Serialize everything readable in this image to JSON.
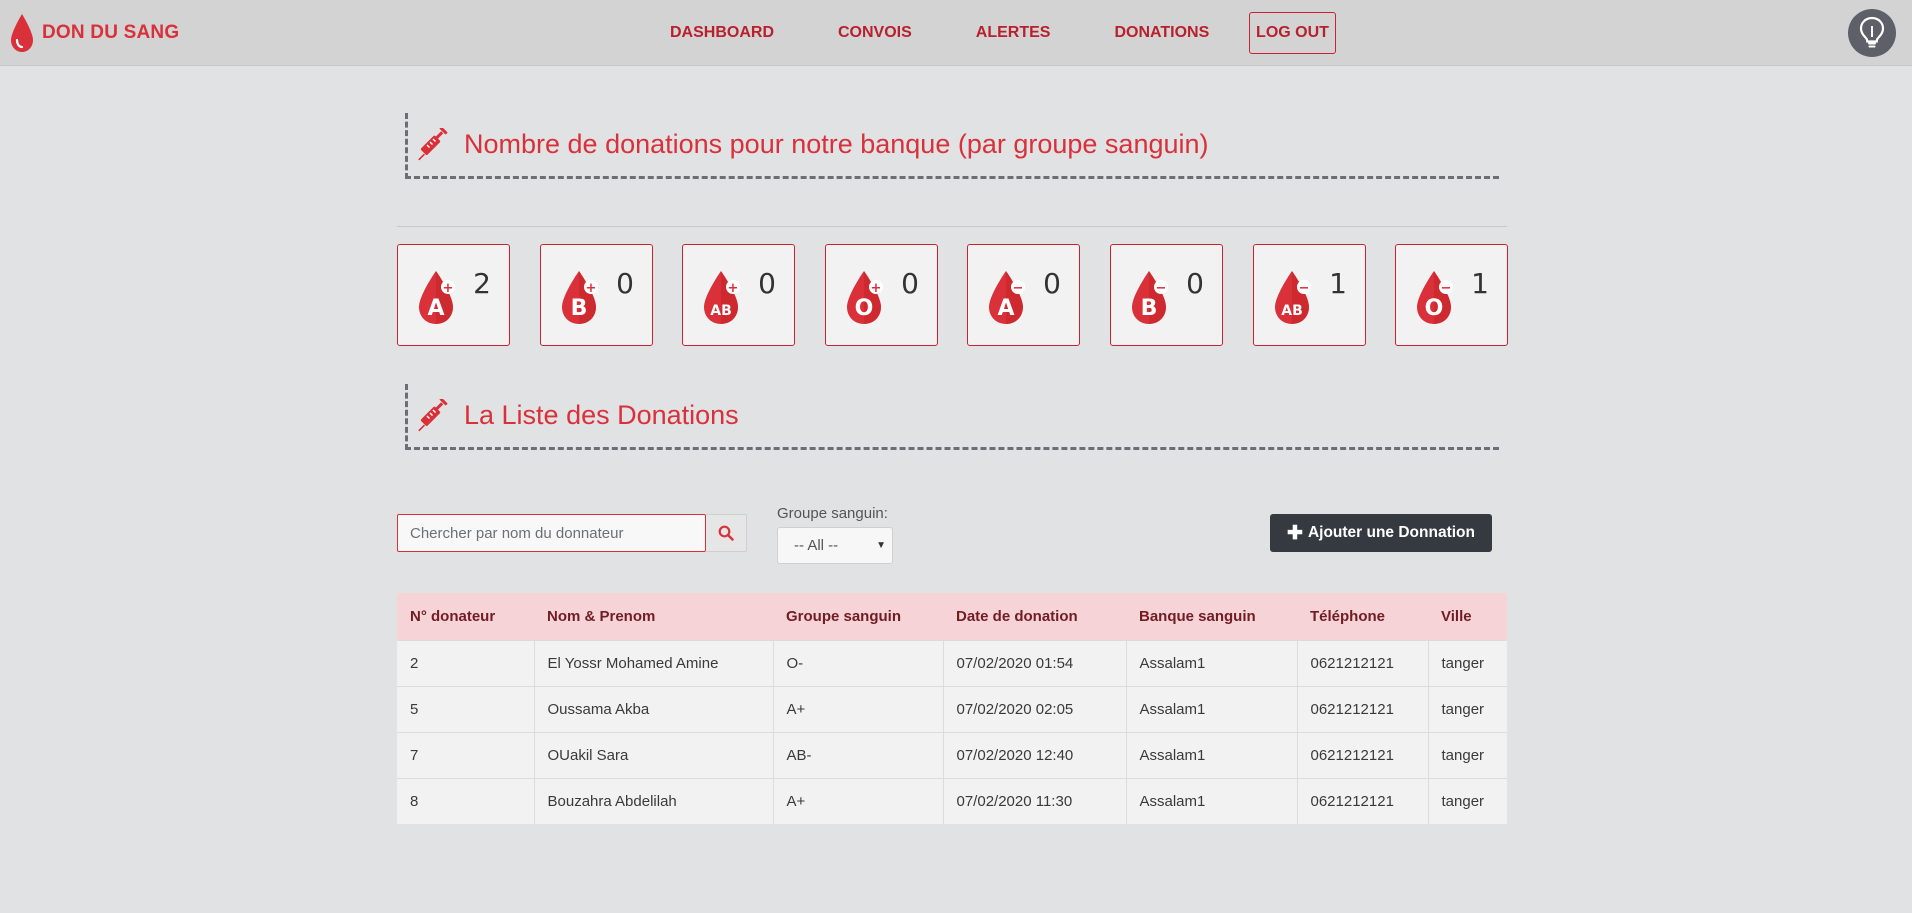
{
  "brand": {
    "name": "DON DU SANG",
    "color": "#d9303a",
    "icon": "blood-drop-icon"
  },
  "nav": {
    "items": [
      "DASHBOARD",
      "CONVOIS",
      "ALERTES",
      "DONATIONS"
    ],
    "logout": "LOG OUT",
    "help_icon": "lightbulb-icon"
  },
  "summary": {
    "title": "Nombre de donations pour notre banque (par groupe sanguin)",
    "icon": "syringe-icon",
    "groups": [
      {
        "type": "A",
        "sign": "+",
        "count": "2"
      },
      {
        "type": "B",
        "sign": "+",
        "count": "0"
      },
      {
        "type": "AB",
        "sign": "+",
        "count": "0"
      },
      {
        "type": "O",
        "sign": "+",
        "count": "0"
      },
      {
        "type": "A",
        "sign": "-",
        "count": "0"
      },
      {
        "type": "B",
        "sign": "-",
        "count": "0"
      },
      {
        "type": "AB",
        "sign": "-",
        "count": "1"
      },
      {
        "type": "O",
        "sign": "-",
        "count": "1"
      }
    ]
  },
  "list": {
    "title": "La Liste des Donations",
    "icon": "syringe-icon",
    "search": {
      "placeholder": "Chercher par nom du donnateur",
      "value": ""
    },
    "filter": {
      "label": "Groupe sanguin:",
      "selected": "-- All --"
    },
    "add_button": "Ajouter une Donnation",
    "columns": [
      "N° donateur",
      "Nom & Prenom",
      "Groupe sanguin",
      "Date de donation",
      "Banque sanguin",
      "Téléphone",
      "Ville"
    ],
    "rows": [
      [
        "2",
        "El Yossr Mohamed Amine",
        "O-",
        "07/02/2020 01:54",
        "Assalam1",
        "0621212121",
        "tanger"
      ],
      [
        "5",
        "Oussama Akba",
        "A+",
        "07/02/2020 02:05",
        "Assalam1",
        "0621212121",
        "tanger"
      ],
      [
        "7",
        "OUakil Sara",
        "AB-",
        "07/02/2020 12:40",
        "Assalam1",
        "0621212121",
        "tanger"
      ],
      [
        "8",
        "Bouzahra Abdelilah",
        "A+",
        "07/02/2020 11:30",
        "Assalam1",
        "0621212121",
        "tanger"
      ]
    ]
  },
  "colors": {
    "accent": "#d9303a",
    "dark_button": "#343a40",
    "table_header": "#f5d3d6",
    "background": "#e1e2e4"
  }
}
